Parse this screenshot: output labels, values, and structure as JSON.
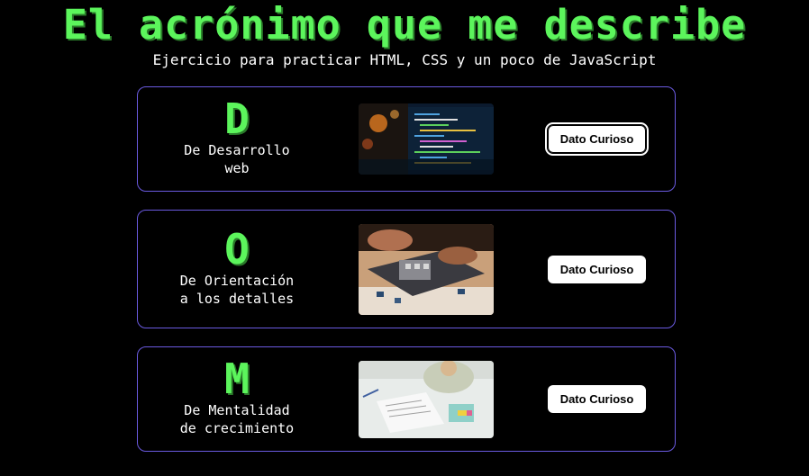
{
  "header": {
    "title": "El acrónimo que me describe",
    "subtitle": "Ejercicio para practicar HTML, CSS y un poco de JavaScript"
  },
  "cards": [
    {
      "letter": "D",
      "description": "De Desarrollo\nweb",
      "image_icon": "code-monitor-photo",
      "button_label": "Dato Curioso"
    },
    {
      "letter": "O",
      "description": "De Orientación\na los detalles",
      "image_icon": "puzzle-photo",
      "button_label": "Dato Curioso"
    },
    {
      "letter": "M",
      "description": "De Mentalidad\nde crecimiento",
      "image_icon": "studying-photo",
      "button_label": "Dato Curioso"
    }
  ],
  "colors": {
    "accent_green": "#5cf55c",
    "card_border": "#6a5ae0",
    "background": "#000000"
  }
}
